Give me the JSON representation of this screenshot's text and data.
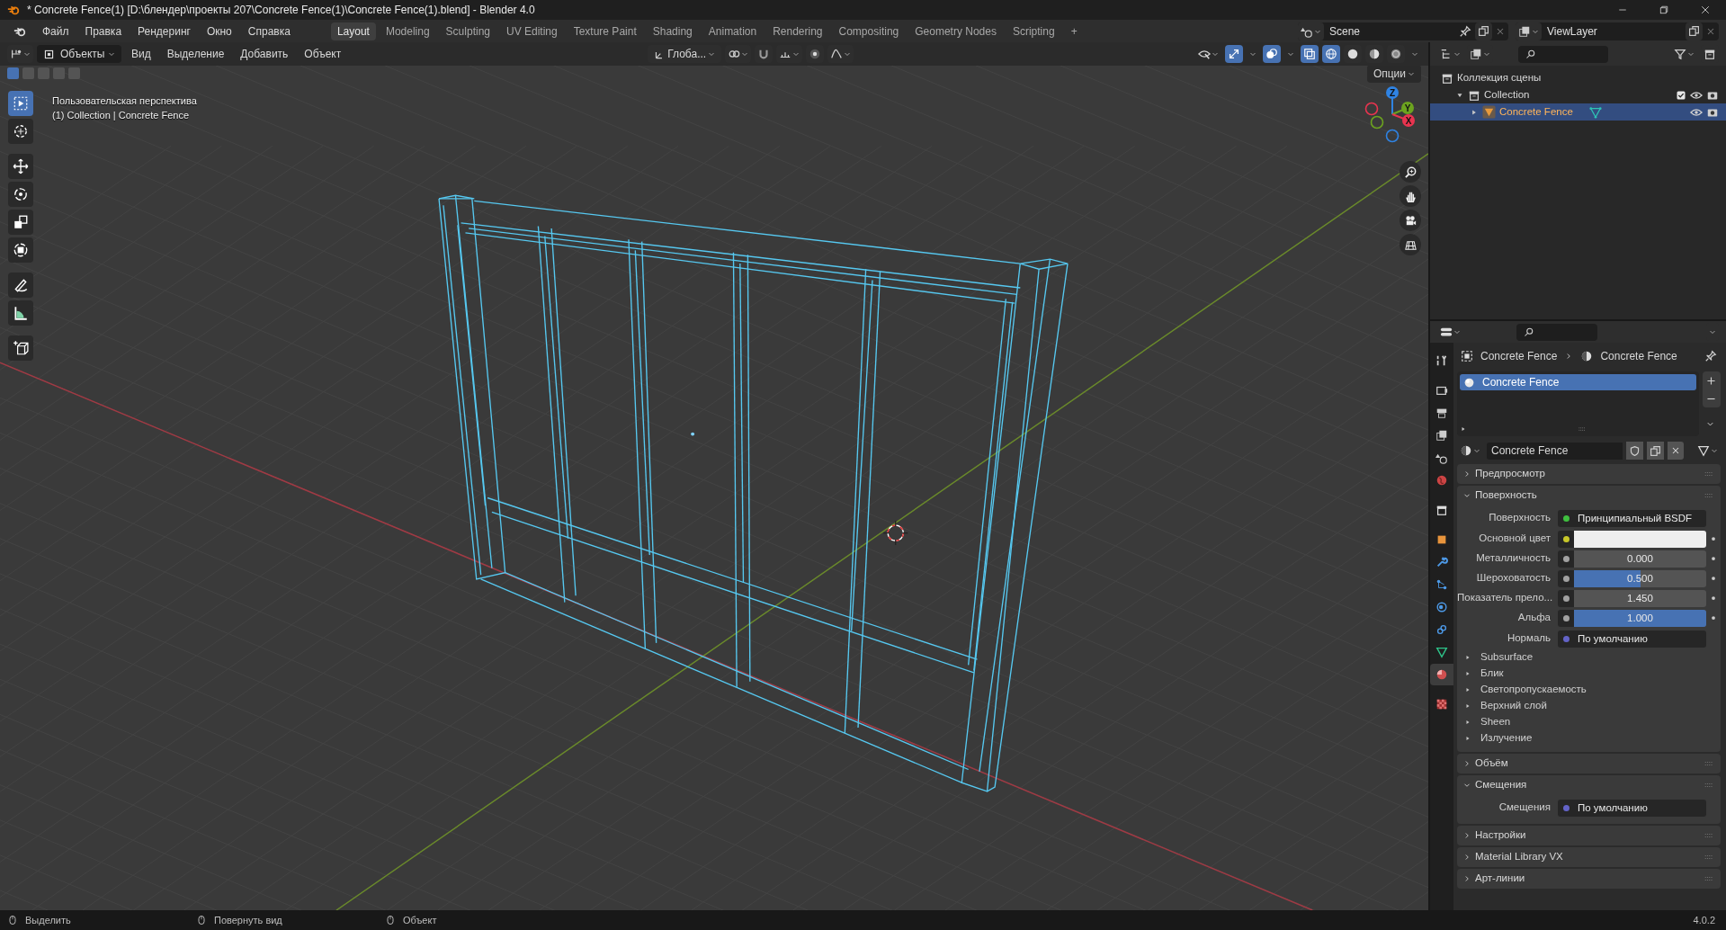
{
  "window": {
    "title": "* Concrete Fence(1) [D:\\блендер\\проекты 207\\Concrete Fence(1)\\Concrete Fence(1).blend] - Blender 4.0"
  },
  "menu": [
    "Файл",
    "Правка",
    "Рендеринг",
    "Окно",
    "Справка"
  ],
  "workspaces": [
    {
      "label": "Layout",
      "selected": true
    },
    {
      "label": "Modeling",
      "selected": false
    },
    {
      "label": "Sculpting",
      "selected": false
    },
    {
      "label": "UV Editing",
      "selected": false
    },
    {
      "label": "Texture Paint",
      "selected": false
    },
    {
      "label": "Shading",
      "selected": false
    },
    {
      "label": "Animation",
      "selected": false
    },
    {
      "label": "Rendering",
      "selected": false
    },
    {
      "label": "Compositing",
      "selected": false
    },
    {
      "label": "Geometry Nodes",
      "selected": false
    },
    {
      "label": "Scripting",
      "selected": false
    }
  ],
  "add_workspace": "+",
  "scene": "Scene",
  "view_layer": "ViewLayer",
  "viewport": {
    "mode": "Объекты",
    "menus": [
      "Вид",
      "Выделение",
      "Добавить",
      "Объект"
    ],
    "orientation": "Глоба...",
    "options": "Опции",
    "toggles": [
      {
        "kind": "gizmo",
        "on": true
      },
      {
        "kind": "overlay",
        "on": true
      },
      {
        "kind": "xray",
        "on": true
      }
    ],
    "shading": [
      {
        "kind": "wireframe",
        "selected": true
      },
      {
        "kind": "solid",
        "selected": false
      },
      {
        "kind": "material",
        "selected": false
      },
      {
        "kind": "rendered",
        "selected": false
      }
    ],
    "select_modes": [
      {
        "selected": true
      },
      {
        "selected": false
      },
      {
        "selected": false
      },
      {
        "selected": false
      },
      {
        "selected": false
      }
    ],
    "tools": [
      {
        "kind": "select",
        "selected": true
      },
      {
        "kind": "cursor",
        "selected": false
      },
      {
        "kind": "move",
        "selected": false
      },
      {
        "kind": "rotate",
        "selected": false
      },
      {
        "kind": "scale",
        "selected": false
      },
      {
        "kind": "transform",
        "selected": false
      },
      {
        "kind": "annotate",
        "selected": false
      },
      {
        "kind": "measure",
        "selected": false
      },
      {
        "kind": "add_cube",
        "selected": false
      }
    ],
    "view_name": "Пользовательская перспектива",
    "context": "(1) Collection | Concrete Fence",
    "gizmo": [
      {
        "label": "Z",
        "color": "#2f83e3"
      },
      {
        "label": "Y",
        "color": "#6ca31f"
      },
      {
        "label": "X",
        "color": "#e8344f"
      }
    ]
  },
  "outliner": {
    "items": [
      {
        "label": "Коллекция сцены",
        "kind": "scene_collection",
        "selected": false,
        "children": [
          {
            "label": "Collection",
            "kind": "collection",
            "selected": false,
            "expanded": true,
            "checked": true,
            "children": [
              {
                "label": "Concrete Fence",
                "kind": "object",
                "selected": true,
                "expanded": false
              }
            ]
          }
        ]
      }
    ]
  },
  "properties": {
    "breadcrumb": [
      "Concrete Fence",
      "Concrete Fence"
    ],
    "tabs": [
      {
        "kind": "tool",
        "selected": false
      },
      {
        "kind": "render",
        "selected": false
      },
      {
        "kind": "output",
        "selected": false
      },
      {
        "kind": "view_layer",
        "selected": false
      },
      {
        "kind": "scene",
        "selected": false
      },
      {
        "kind": "world",
        "selected": false
      },
      {
        "kind": "collection",
        "selected": false
      },
      {
        "kind": "object",
        "selected": false
      },
      {
        "kind": "modifiers",
        "selected": false
      },
      {
        "kind": "particles",
        "selected": false
      },
      {
        "kind": "physics",
        "selected": false
      },
      {
        "kind": "constraints",
        "selected": false
      },
      {
        "kind": "data",
        "selected": false
      },
      {
        "kind": "material",
        "selected": true
      },
      {
        "kind": "texture",
        "selected": false
      }
    ],
    "material_slots": [
      {
        "label": "Concrete Fence",
        "selected": true
      }
    ],
    "material_name": "Concrete Fence",
    "panels": [
      {
        "title": "Предпросмотр",
        "expanded": false
      },
      {
        "title": "Поверхность",
        "expanded": true,
        "rows": [
          {
            "kind": "link",
            "label": "Поверхность",
            "value": "Принципиальный BSDF",
            "color": "#3fbf3f"
          },
          {
            "kind": "swatch",
            "label": "Основной цвет",
            "color": "#c7c729"
          },
          {
            "kind": "slider",
            "label": "Металличность",
            "value": "0.000",
            "level": 0,
            "color": "#a1a1a1"
          },
          {
            "kind": "slider",
            "label": "Шероховатость",
            "value": "0.500",
            "level": 0.5,
            "color": "#a1a1a1"
          },
          {
            "kind": "number",
            "label": "Показатель прело...",
            "value": "1.450",
            "color": "#a1a1a1"
          },
          {
            "kind": "slider",
            "label": "Альфа",
            "value": "1.000",
            "level": 1,
            "color": "#a1a1a1"
          },
          {
            "kind": "link",
            "label": "Нормаль",
            "value": "По умолчанию",
            "color": "#6363c7"
          },
          {
            "kind": "subpanel",
            "label": "Subsurface",
            "expanded": false
          },
          {
            "kind": "subpanel",
            "label": "Блик",
            "expanded": false
          },
          {
            "kind": "subpanel",
            "label": "Светопропускаемость",
            "expanded": false
          },
          {
            "kind": "subpanel",
            "label": "Верхний слой",
            "expanded": false
          },
          {
            "kind": "subpanel",
            "label": "Sheen",
            "expanded": false
          },
          {
            "kind": "subpanel",
            "label": "Излучение",
            "expanded": false
          }
        ]
      },
      {
        "title": "Объём",
        "expanded": false
      },
      {
        "title": "Смещения",
        "expanded": true,
        "rows": [
          {
            "kind": "link",
            "label": "Смещения",
            "value": "По умолчанию",
            "color": "#6363c7"
          }
        ]
      },
      {
        "title": "Настройки",
        "expanded": false
      },
      {
        "title": "Material Library VX",
        "expanded": false
      },
      {
        "title": "Арт-линии",
        "expanded": false
      }
    ]
  },
  "status_bar": {
    "items": [
      {
        "label": "Выделить"
      },
      {
        "label": "Повернуть вид"
      },
      {
        "label": "Объект"
      }
    ],
    "version": "4.0.2"
  }
}
